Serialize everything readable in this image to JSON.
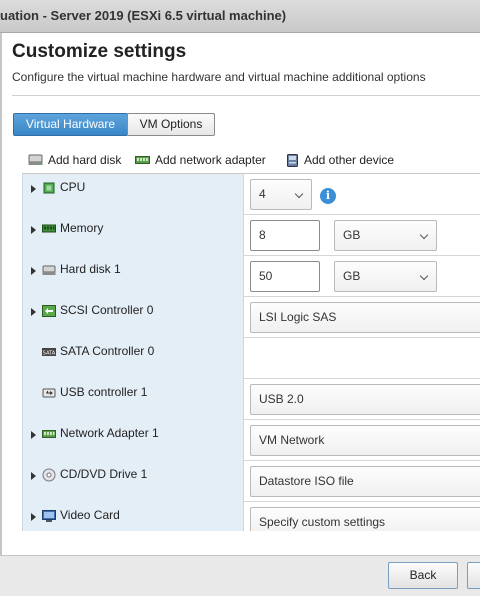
{
  "window": {
    "title": "uation - Server 2019 (ESXi 6.5 virtual machine)"
  },
  "header": {
    "title": "Customize settings",
    "subtitle": "Configure the virtual machine hardware and virtual machine additional options"
  },
  "tabs": [
    {
      "label": "Virtual Hardware",
      "active": true
    },
    {
      "label": "VM Options",
      "active": false
    }
  ],
  "toolbar": {
    "add_hard_disk": "Add hard disk",
    "add_network_adapter": "Add network adapter",
    "add_other_device": "Add other device"
  },
  "hardware": {
    "cpu": {
      "label": "CPU",
      "value": "4"
    },
    "memory": {
      "label": "Memory",
      "value": "8",
      "unit": "GB"
    },
    "hard_disk": {
      "label": "Hard disk 1",
      "value": "50",
      "unit": "GB"
    },
    "scsi": {
      "label": "SCSI Controller 0",
      "value": "LSI Logic SAS"
    },
    "sata": {
      "label": "SATA Controller 0"
    },
    "usb": {
      "label": "USB controller 1",
      "value": "USB 2.0"
    },
    "network": {
      "label": "Network Adapter 1",
      "value": "VM Network"
    },
    "cdrom": {
      "label": "CD/DVD Drive 1",
      "value": "Datastore ISO file"
    },
    "video": {
      "label": "Video Card",
      "value": "Specify custom settings"
    }
  },
  "footer": {
    "back_label": "Back"
  },
  "colors": {
    "accent": "#3a86c8",
    "row_label_bg": "#e4eef7",
    "info": "#3c8fd6"
  }
}
